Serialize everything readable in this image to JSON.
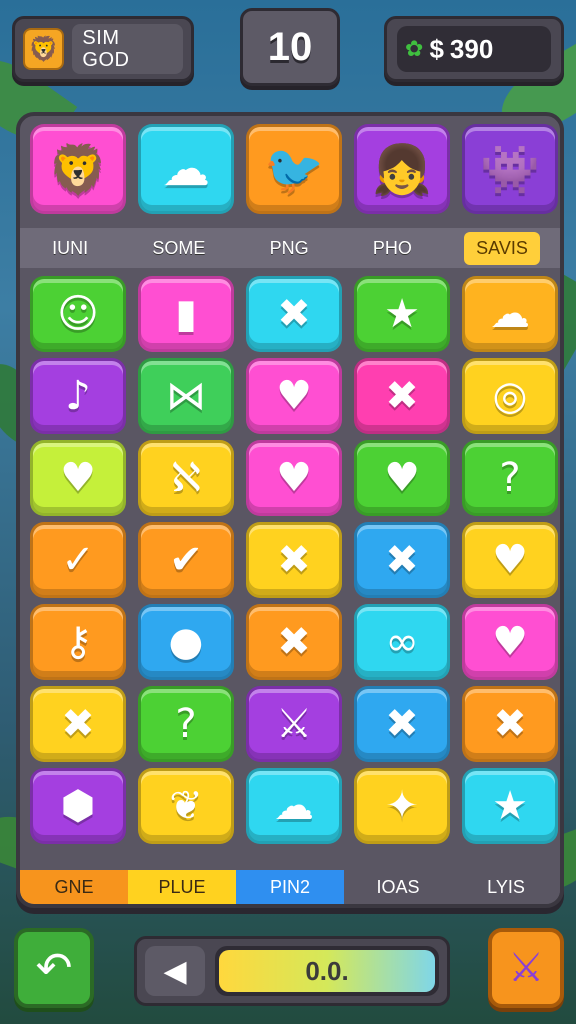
{
  "header": {
    "player_line1": "SIM",
    "player_line2": "GOD",
    "player_avatar_icon": "lion-icon",
    "moves": "10",
    "coins_icon": "clover-icon",
    "coins_currency": "$",
    "coins_value": "390"
  },
  "characters": [
    {
      "name": "lion",
      "glyph": "🦁",
      "color": "#ff4fd2"
    },
    {
      "name": "cloud",
      "glyph": "☁",
      "color": "#2fd7f0"
    },
    {
      "name": "bird",
      "glyph": "🐦",
      "color": "#ff9a1f"
    },
    {
      "name": "girl",
      "glyph": "👧",
      "color": "#a43fe0"
    },
    {
      "name": "monster",
      "glyph": "👾",
      "color": "#8a3fd6"
    }
  ],
  "tabs": [
    {
      "label": "IUNI",
      "active": false
    },
    {
      "label": "SOME",
      "active": false
    },
    {
      "label": "PNG",
      "active": false
    },
    {
      "label": "PHO",
      "active": false
    },
    {
      "label": "SAVIS",
      "active": true
    }
  ],
  "tiles": [
    [
      {
        "icon": "smiley-icon",
        "glyph": "☺",
        "color": "#4cd134"
      },
      {
        "icon": "capsule-icon",
        "glyph": "▮",
        "color": "#ff4fd2"
      },
      {
        "icon": "x-icon",
        "glyph": "✖",
        "color": "#2fd7f0"
      },
      {
        "icon": "star-icon",
        "glyph": "★",
        "color": "#4cd134"
      },
      {
        "icon": "cloud-icon",
        "glyph": "☁",
        "color": "#ffb31f"
      }
    ],
    [
      {
        "icon": "music-note-icon",
        "glyph": "♪",
        "color": "#a43fe0"
      },
      {
        "icon": "ribbon-icon",
        "glyph": "⋈",
        "color": "#3fcf5a"
      },
      {
        "icon": "heart-icon",
        "glyph": "♥",
        "color": "#ff4fd2"
      },
      {
        "icon": "x-icon",
        "glyph": "✖",
        "color": "#ff3fb0"
      },
      {
        "icon": "spiral-icon",
        "glyph": "◎",
        "color": "#ffd21f"
      }
    ],
    [
      {
        "icon": "heart-icon",
        "glyph": "♥",
        "color": "#c5f03a"
      },
      {
        "icon": "ribbon-icon",
        "glyph": "ℵ",
        "color": "#ffd21f"
      },
      {
        "icon": "heart-icon",
        "glyph": "♥",
        "color": "#ff4fd2"
      },
      {
        "icon": "heart-icon",
        "glyph": "♥",
        "color": "#4cd134"
      },
      {
        "icon": "question-icon",
        "glyph": "?",
        "color": "#4cd134"
      }
    ],
    [
      {
        "icon": "hook-icon",
        "glyph": "✓",
        "color": "#ff9a1f"
      },
      {
        "icon": "check-icon",
        "glyph": "✔",
        "color": "#ff9a1f"
      },
      {
        "icon": "x-icon",
        "glyph": "✖",
        "color": "#ffd21f"
      },
      {
        "icon": "x-icon",
        "glyph": "✖",
        "color": "#2fa8f0"
      },
      {
        "icon": "heart-icon",
        "glyph": "♥",
        "color": "#ffd21f"
      }
    ],
    [
      {
        "icon": "key-icon",
        "glyph": "⚷",
        "color": "#ff9a1f"
      },
      {
        "icon": "ring-icon",
        "glyph": "●",
        "color": "#2fa8f0"
      },
      {
        "icon": "x-icon",
        "glyph": "✖",
        "color": "#ff9a1f"
      },
      {
        "icon": "pretzel-icon",
        "glyph": "∞",
        "color": "#2fd7f0"
      },
      {
        "icon": "heart-icon",
        "glyph": "♥",
        "color": "#ff4fd2"
      }
    ],
    [
      {
        "icon": "x-icon",
        "glyph": "✖",
        "color": "#ffd21f"
      },
      {
        "icon": "question-icon",
        "glyph": "?",
        "color": "#4cd134"
      },
      {
        "icon": "sword-icon",
        "glyph": "⚔",
        "color": "#a43fe0"
      },
      {
        "icon": "x-icon",
        "glyph": "✖",
        "color": "#2fa8f0"
      },
      {
        "icon": "x-icon",
        "glyph": "✖",
        "color": "#ff9a1f"
      }
    ],
    [
      {
        "icon": "gem-icon",
        "glyph": "⬢",
        "color": "#a43fe0"
      },
      {
        "icon": "apple-icon",
        "glyph": "❦",
        "color": "#ffd21f"
      },
      {
        "icon": "cloud-icon",
        "glyph": "☁",
        "color": "#2fd7f0"
      },
      {
        "icon": "star-icon",
        "glyph": "✦",
        "color": "#ffd21f"
      },
      {
        "icon": "star-icon",
        "glyph": "★",
        "color": "#2fd7f0"
      }
    ]
  ],
  "bottom_tabs": [
    {
      "label": "GNE",
      "bg": "#f7941d",
      "fg": "#3b2a14"
    },
    {
      "label": "PLUE",
      "bg": "#ffd21f",
      "fg": "#3b2a14"
    },
    {
      "label": "PIN2",
      "bg": "#2f8ff0",
      "fg": "#ffffff"
    },
    {
      "label": "IOAS",
      "bg": "#5a5663",
      "fg": "#ffffff"
    },
    {
      "label": "LYIS",
      "bg": "#5a5663",
      "fg": "#ffffff"
    }
  ],
  "controls": {
    "undo_glyph": "↶",
    "back_glyph": "◀",
    "progress_label": "0.0.",
    "power_glyph": "⚔"
  }
}
